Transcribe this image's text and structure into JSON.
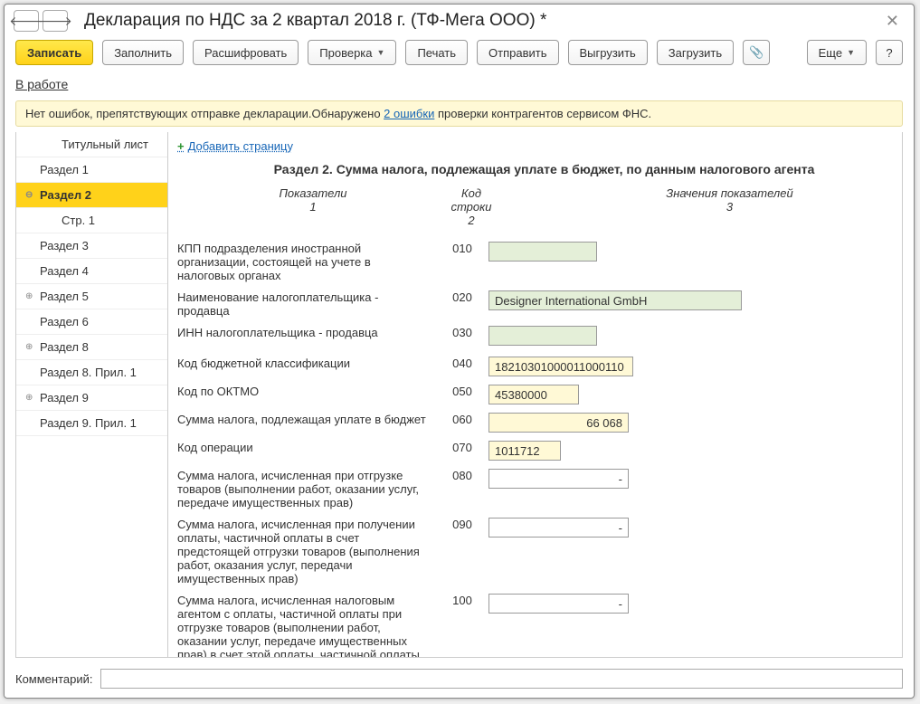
{
  "header": {
    "title": "Декларация по НДС за 2 квартал 2018 г. (ТФ-Мега ООО) *"
  },
  "toolbar": {
    "write": "Записать",
    "fill": "Заполнить",
    "decode": "Расшифровать",
    "check": "Проверка",
    "print": "Печать",
    "send": "Отправить",
    "upload": "Выгрузить",
    "download": "Загрузить",
    "more": "Еще"
  },
  "status_link": "В работе",
  "warning": {
    "prefix": "Нет ошибок, препятствующих отправке декларации.Обнаружено ",
    "link": "2 ошибки",
    "suffix": " проверки контрагентов сервисом ФНС."
  },
  "sections": [
    {
      "label": "Титульный лист",
      "indent": 1
    },
    {
      "label": "Раздел 1"
    },
    {
      "label": "Раздел 2",
      "expander": "⊖",
      "selected": true
    },
    {
      "label": "Стр. 1",
      "indent": 1
    },
    {
      "label": "Раздел 3"
    },
    {
      "label": "Раздел 4"
    },
    {
      "label": "Раздел 5",
      "expander": "⊕"
    },
    {
      "label": "Раздел 6"
    },
    {
      "label": "Раздел 8",
      "expander": "⊕"
    },
    {
      "label": "Раздел 8. Прил. 1"
    },
    {
      "label": "Раздел 9",
      "expander": "⊕"
    },
    {
      "label": "Раздел 9. Прил. 1"
    }
  ],
  "content": {
    "add_page": "Добавить страницу",
    "section_title": "Раздел 2. Сумма налога, подлежащая уплате в бюджет, по данным налогового агента",
    "head1a": "Показатели",
    "head1b": "1",
    "head2a": "Код строки",
    "head2b": "2",
    "head3a": "Значения показателей",
    "head3b": "3",
    "rows": [
      {
        "label": "КПП подразделения иностранной организации, состоящей на учете в налоговых органах",
        "code": "010",
        "value": "",
        "ftype": "green",
        "w": "w120"
      },
      {
        "label": "Наименование налогоплательщика - продавца",
        "code": "020",
        "value": "Designer International GmbH",
        "ftype": "green",
        "w": "w280"
      },
      {
        "label": "ИНН налогоплательщика - продавца",
        "code": "030",
        "value": "",
        "ftype": "green",
        "w": "w120"
      },
      {
        "label": "Код бюджетной классификации",
        "code": "040",
        "value": "18210301000011000110",
        "ftype": "yellow",
        "w": "w160"
      },
      {
        "label": "Код по ОКТМО",
        "code": "050",
        "value": "45380000",
        "ftype": "yellow",
        "w": "w100"
      },
      {
        "label": "Сумма налога, подлежащая уплате в бюджет",
        "code": "060",
        "value": "66 068",
        "ftype": "yellow",
        "w": "w155",
        "align": "right"
      },
      {
        "label": "Код операции",
        "code": "070",
        "value": "1011712",
        "ftype": "yellow",
        "w": "w80"
      },
      {
        "label": "Сумма налога, исчисленная при отгрузке товаров (выполнении работ, оказании услуг, передаче имущественных прав)",
        "code": "080",
        "value": "-",
        "ftype": "plain",
        "w": "w155",
        "align": "right"
      },
      {
        "label": "Сумма налога, исчисленная при получении оплаты, частичной оплаты в счет предстоящей отгрузки товаров (выполнения работ, оказания услуг, передачи имущественных прав)",
        "code": "090",
        "value": "-",
        "ftype": "plain",
        "w": "w155",
        "align": "right"
      },
      {
        "label": "Сумма налога, исчисленная налоговым агентом с оплаты, частичной оплаты при отгрузке товаров (выполнении работ, оказании услуг, передаче имущественных прав) в счет этой оплаты, частичной оплаты",
        "code": "100",
        "value": "-",
        "ftype": "plain",
        "w": "w155",
        "align": "right"
      }
    ]
  },
  "footer": {
    "label": "Комментарий:",
    "value": ""
  }
}
